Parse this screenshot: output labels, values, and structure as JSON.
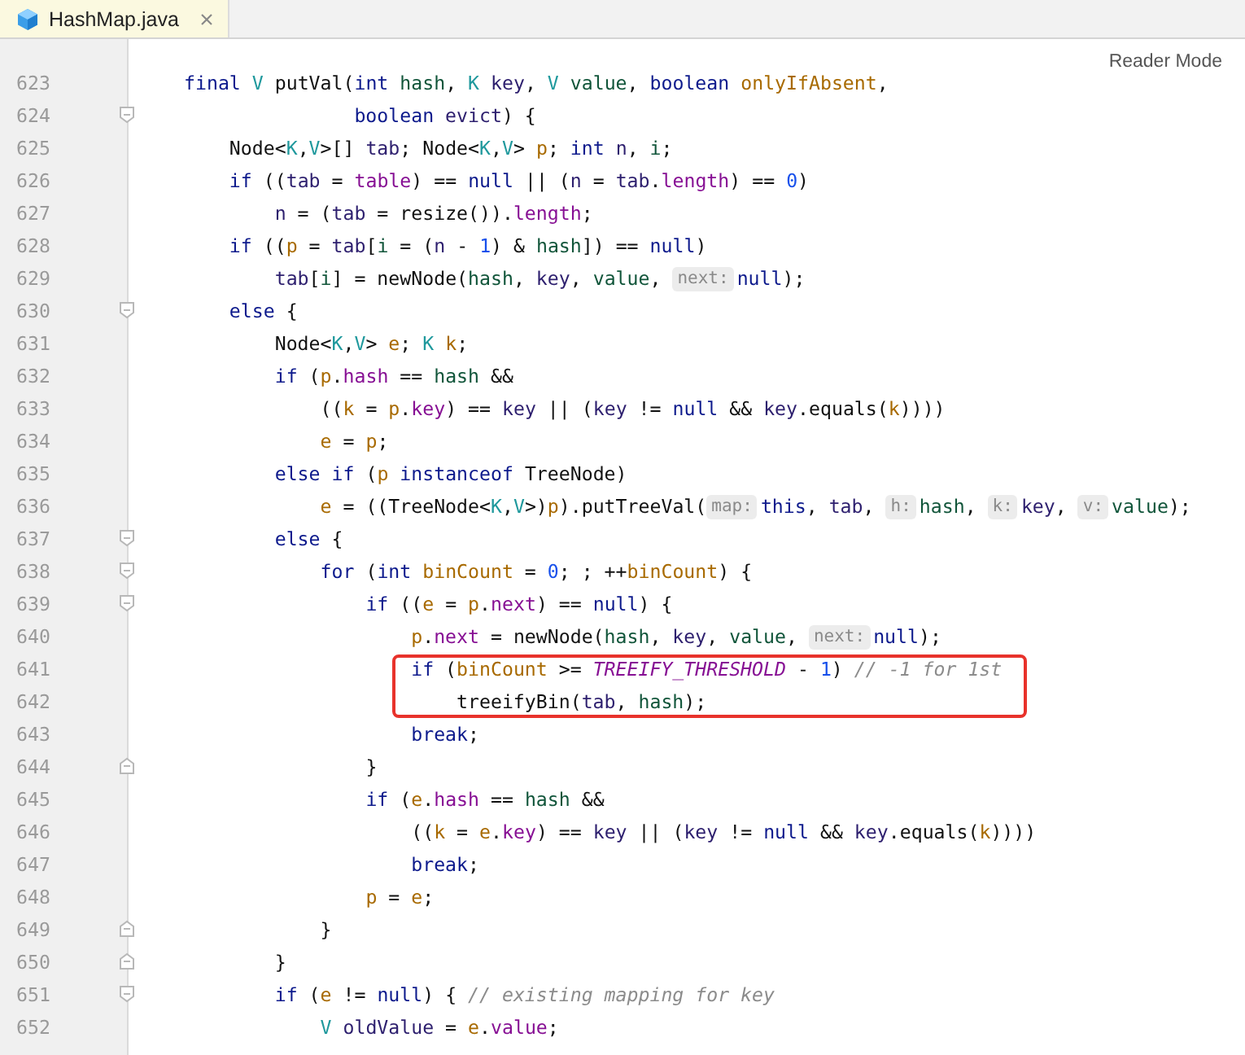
{
  "tabs": [
    {
      "label": "HashMap.java",
      "selected": true
    }
  ],
  "reader_mode": "Reader Mode",
  "lines": [
    {
      "number": "623",
      "highlighted": false,
      "fold_start": false,
      "fold_end": false,
      "tokens": [
        {
          "text": "final ",
          "kind": "kw"
        },
        {
          "text": "V",
          "kind": "type"
        },
        {
          "text": " putVal(",
          "kind": "plain"
        },
        {
          "text": "int ",
          "kind": "kw"
        },
        {
          "text": "hash",
          "kind": "green"
        },
        {
          "text": ", ",
          "kind": "plain"
        },
        {
          "text": "K ",
          "kind": "type"
        },
        {
          "text": "key",
          "kind": "local"
        },
        {
          "text": ", ",
          "kind": "plain"
        },
        {
          "text": "V ",
          "kind": "type"
        },
        {
          "text": "value",
          "kind": "green"
        },
        {
          "text": ", ",
          "kind": "plain"
        },
        {
          "text": "boolean ",
          "kind": "kw"
        },
        {
          "text": "onlyIfAbsent",
          "kind": "brown"
        },
        {
          "text": ",",
          "kind": "plain"
        }
      ]
    },
    {
      "number": "624",
      "highlighted": false,
      "fold_start": true,
      "fold_end": false,
      "tokens": [
        {
          "text": "               boolean ",
          "kind": "kw"
        },
        {
          "text": "evict",
          "kind": "local"
        },
        {
          "text": ") {",
          "kind": "plain"
        }
      ]
    },
    {
      "number": "625",
      "highlighted": false,
      "fold_start": false,
      "fold_end": false,
      "tokens": [
        {
          "text": "    Node<",
          "kind": "plain"
        },
        {
          "text": "K",
          "kind": "type"
        },
        {
          "text": ",",
          "kind": "plain"
        },
        {
          "text": "V",
          "kind": "type"
        },
        {
          "text": ">[] ",
          "kind": "plain"
        },
        {
          "text": "tab",
          "kind": "local"
        },
        {
          "text": "; Node<",
          "kind": "plain"
        },
        {
          "text": "K",
          "kind": "type"
        },
        {
          "text": ",",
          "kind": "plain"
        },
        {
          "text": "V",
          "kind": "type"
        },
        {
          "text": "> ",
          "kind": "plain"
        },
        {
          "text": "p",
          "kind": "brown"
        },
        {
          "text": "; ",
          "kind": "plain"
        },
        {
          "text": "int ",
          "kind": "kw"
        },
        {
          "text": "n",
          "kind": "local"
        },
        {
          "text": ", ",
          "kind": "plain"
        },
        {
          "text": "i",
          "kind": "green"
        },
        {
          "text": ";",
          "kind": "plain"
        }
      ]
    },
    {
      "number": "626",
      "highlighted": false,
      "fold_start": false,
      "fold_end": false,
      "tokens": [
        {
          "text": "    if",
          "kind": "kw"
        },
        {
          "text": " ((",
          "kind": "plain"
        },
        {
          "text": "tab",
          "kind": "local"
        },
        {
          "text": " = ",
          "kind": "plain"
        },
        {
          "text": "table",
          "kind": "field"
        },
        {
          "text": ") == ",
          "kind": "plain"
        },
        {
          "text": "null",
          "kind": "kw"
        },
        {
          "text": " || (",
          "kind": "plain"
        },
        {
          "text": "n",
          "kind": "local"
        },
        {
          "text": " = ",
          "kind": "plain"
        },
        {
          "text": "tab",
          "kind": "local"
        },
        {
          "text": ".",
          "kind": "plain"
        },
        {
          "text": "length",
          "kind": "field"
        },
        {
          "text": ") == ",
          "kind": "plain"
        },
        {
          "text": "0",
          "kind": "num"
        },
        {
          "text": ")",
          "kind": "plain"
        }
      ]
    },
    {
      "number": "627",
      "highlighted": false,
      "fold_start": false,
      "fold_end": false,
      "tokens": [
        {
          "text": "        n",
          "kind": "local"
        },
        {
          "text": " = (",
          "kind": "plain"
        },
        {
          "text": "tab",
          "kind": "local"
        },
        {
          "text": " = resize()).",
          "kind": "plain"
        },
        {
          "text": "length",
          "kind": "field"
        },
        {
          "text": ";",
          "kind": "plain"
        }
      ]
    },
    {
      "number": "628",
      "highlighted": false,
      "fold_start": false,
      "fold_end": false,
      "tokens": [
        {
          "text": "    if",
          "kind": "kw"
        },
        {
          "text": " ((",
          "kind": "plain"
        },
        {
          "text": "p",
          "kind": "brown"
        },
        {
          "text": " = ",
          "kind": "plain"
        },
        {
          "text": "tab",
          "kind": "local"
        },
        {
          "text": "[",
          "kind": "plain"
        },
        {
          "text": "i",
          "kind": "green"
        },
        {
          "text": " = (",
          "kind": "plain"
        },
        {
          "text": "n",
          "kind": "local"
        },
        {
          "text": " - ",
          "kind": "plain"
        },
        {
          "text": "1",
          "kind": "num"
        },
        {
          "text": ") & ",
          "kind": "plain"
        },
        {
          "text": "hash",
          "kind": "green"
        },
        {
          "text": "]) == ",
          "kind": "plain"
        },
        {
          "text": "null",
          "kind": "kw"
        },
        {
          "text": ")",
          "kind": "plain"
        }
      ]
    },
    {
      "number": "629",
      "highlighted": false,
      "fold_start": false,
      "fold_end": false,
      "tokens": [
        {
          "text": "        tab",
          "kind": "local"
        },
        {
          "text": "[",
          "kind": "plain"
        },
        {
          "text": "i",
          "kind": "green"
        },
        {
          "text": "] = newNode(",
          "kind": "plain"
        },
        {
          "text": "hash",
          "kind": "green"
        },
        {
          "text": ", ",
          "kind": "plain"
        },
        {
          "text": "key",
          "kind": "local"
        },
        {
          "text": ", ",
          "kind": "plain"
        },
        {
          "text": "value",
          "kind": "green"
        },
        {
          "text": ", ",
          "kind": "plain"
        },
        {
          "text": "next:",
          "kind": "hint"
        },
        {
          "text": "null",
          "kind": "kw"
        },
        {
          "text": ");",
          "kind": "plain"
        }
      ]
    },
    {
      "number": "630",
      "highlighted": false,
      "fold_start": true,
      "fold_end": false,
      "tokens": [
        {
          "text": "    else",
          "kind": "kw"
        },
        {
          "text": " {",
          "kind": "plain"
        }
      ]
    },
    {
      "number": "631",
      "highlighted": false,
      "fold_start": false,
      "fold_end": false,
      "tokens": [
        {
          "text": "        Node<",
          "kind": "plain"
        },
        {
          "text": "K",
          "kind": "type"
        },
        {
          "text": ",",
          "kind": "plain"
        },
        {
          "text": "V",
          "kind": "type"
        },
        {
          "text": "> ",
          "kind": "plain"
        },
        {
          "text": "e",
          "kind": "brown"
        },
        {
          "text": "; ",
          "kind": "plain"
        },
        {
          "text": "K ",
          "kind": "type"
        },
        {
          "text": "k",
          "kind": "brown"
        },
        {
          "text": ";",
          "kind": "plain"
        }
      ]
    },
    {
      "number": "632",
      "highlighted": false,
      "fold_start": false,
      "fold_end": false,
      "tokens": [
        {
          "text": "        if",
          "kind": "kw"
        },
        {
          "text": " (",
          "kind": "plain"
        },
        {
          "text": "p",
          "kind": "brown"
        },
        {
          "text": ".",
          "kind": "plain"
        },
        {
          "text": "hash",
          "kind": "field"
        },
        {
          "text": " == ",
          "kind": "plain"
        },
        {
          "text": "hash",
          "kind": "green"
        },
        {
          "text": " &&",
          "kind": "plain"
        }
      ]
    },
    {
      "number": "633",
      "highlighted": false,
      "fold_start": false,
      "fold_end": false,
      "tokens": [
        {
          "text": "            ((",
          "kind": "plain"
        },
        {
          "text": "k",
          "kind": "brown"
        },
        {
          "text": " = ",
          "kind": "plain"
        },
        {
          "text": "p",
          "kind": "brown"
        },
        {
          "text": ".",
          "kind": "plain"
        },
        {
          "text": "key",
          "kind": "field"
        },
        {
          "text": ") == ",
          "kind": "plain"
        },
        {
          "text": "key",
          "kind": "local"
        },
        {
          "text": " || (",
          "kind": "plain"
        },
        {
          "text": "key",
          "kind": "local"
        },
        {
          "text": " != ",
          "kind": "plain"
        },
        {
          "text": "null",
          "kind": "kw"
        },
        {
          "text": " && ",
          "kind": "plain"
        },
        {
          "text": "key",
          "kind": "local"
        },
        {
          "text": ".equals(",
          "kind": "plain"
        },
        {
          "text": "k",
          "kind": "brown"
        },
        {
          "text": "))))",
          "kind": "plain"
        }
      ]
    },
    {
      "number": "634",
      "highlighted": false,
      "fold_start": false,
      "fold_end": false,
      "tokens": [
        {
          "text": "            e",
          "kind": "brown"
        },
        {
          "text": " = ",
          "kind": "plain"
        },
        {
          "text": "p",
          "kind": "brown"
        },
        {
          "text": ";",
          "kind": "plain"
        }
      ]
    },
    {
      "number": "635",
      "highlighted": false,
      "fold_start": false,
      "fold_end": false,
      "tokens": [
        {
          "text": "        else if",
          "kind": "kw"
        },
        {
          "text": " (",
          "kind": "plain"
        },
        {
          "text": "p ",
          "kind": "brown"
        },
        {
          "text": "instanceof",
          "kind": "kw"
        },
        {
          "text": " TreeNode)",
          "kind": "plain"
        }
      ]
    },
    {
      "number": "636",
      "highlighted": false,
      "fold_start": false,
      "fold_end": false,
      "tokens": [
        {
          "text": "            e",
          "kind": "brown"
        },
        {
          "text": " = ((TreeNode<",
          "kind": "plain"
        },
        {
          "text": "K",
          "kind": "type"
        },
        {
          "text": ",",
          "kind": "plain"
        },
        {
          "text": "V",
          "kind": "type"
        },
        {
          "text": ">)",
          "kind": "plain"
        },
        {
          "text": "p",
          "kind": "brown"
        },
        {
          "text": ").putTreeVal(",
          "kind": "plain"
        },
        {
          "text": "map:",
          "kind": "hint"
        },
        {
          "text": "this",
          "kind": "kw"
        },
        {
          "text": ", ",
          "kind": "plain"
        },
        {
          "text": "tab",
          "kind": "local"
        },
        {
          "text": ", ",
          "kind": "plain"
        },
        {
          "text": "h:",
          "kind": "hint"
        },
        {
          "text": "hash",
          "kind": "green"
        },
        {
          "text": ", ",
          "kind": "plain"
        },
        {
          "text": "k:",
          "kind": "hint"
        },
        {
          "text": "key",
          "kind": "local"
        },
        {
          "text": ", ",
          "kind": "plain"
        },
        {
          "text": "v:",
          "kind": "hint"
        },
        {
          "text": "value",
          "kind": "green"
        },
        {
          "text": ");",
          "kind": "plain"
        }
      ]
    },
    {
      "number": "637",
      "highlighted": false,
      "fold_start": true,
      "fold_end": false,
      "tokens": [
        {
          "text": "        else",
          "kind": "kw"
        },
        {
          "text": " {",
          "kind": "plain"
        }
      ]
    },
    {
      "number": "638",
      "highlighted": false,
      "fold_start": true,
      "fold_end": false,
      "tokens": [
        {
          "text": "            for",
          "kind": "kw"
        },
        {
          "text": " (",
          "kind": "plain"
        },
        {
          "text": "int ",
          "kind": "kw"
        },
        {
          "text": "binCount",
          "kind": "brown"
        },
        {
          "text": " = ",
          "kind": "plain"
        },
        {
          "text": "0",
          "kind": "num"
        },
        {
          "text": "; ; ++",
          "kind": "plain"
        },
        {
          "text": "binCount",
          "kind": "brown"
        },
        {
          "text": ") {",
          "kind": "plain"
        }
      ]
    },
    {
      "number": "639",
      "highlighted": false,
      "fold_start": true,
      "fold_end": false,
      "tokens": [
        {
          "text": "                if",
          "kind": "kw"
        },
        {
          "text": " ((",
          "kind": "plain"
        },
        {
          "text": "e",
          "kind": "brown"
        },
        {
          "text": " = ",
          "kind": "plain"
        },
        {
          "text": "p",
          "kind": "brown"
        },
        {
          "text": ".",
          "kind": "plain"
        },
        {
          "text": "next",
          "kind": "field"
        },
        {
          "text": ") == ",
          "kind": "plain"
        },
        {
          "text": "null",
          "kind": "kw"
        },
        {
          "text": ") {",
          "kind": "plain"
        }
      ]
    },
    {
      "number": "640",
      "highlighted": false,
      "fold_start": false,
      "fold_end": false,
      "tokens": [
        {
          "text": "                    p",
          "kind": "brown"
        },
        {
          "text": ".",
          "kind": "plain"
        },
        {
          "text": "next",
          "kind": "field"
        },
        {
          "text": " = newNode(",
          "kind": "plain"
        },
        {
          "text": "hash",
          "kind": "green"
        },
        {
          "text": ", ",
          "kind": "plain"
        },
        {
          "text": "key",
          "kind": "local"
        },
        {
          "text": ", ",
          "kind": "plain"
        },
        {
          "text": "value",
          "kind": "green"
        },
        {
          "text": ", ",
          "kind": "plain"
        },
        {
          "text": "next:",
          "kind": "hint"
        },
        {
          "text": "null",
          "kind": "kw"
        },
        {
          "text": ");",
          "kind": "plain"
        }
      ]
    },
    {
      "number": "641",
      "highlighted": true,
      "fold_start": false,
      "fold_end": false,
      "tokens": [
        {
          "text": "                    if",
          "kind": "kw"
        },
        {
          "text": " (",
          "kind": "plain"
        },
        {
          "text": "binCount",
          "kind": "brown"
        },
        {
          "text": " >= ",
          "kind": "plain"
        },
        {
          "text": "TREEIFY_THRESHOLD",
          "kind": "const"
        },
        {
          "text": " - ",
          "kind": "plain"
        },
        {
          "text": "1",
          "kind": "num"
        },
        {
          "text": ") ",
          "kind": "plain"
        },
        {
          "text": "// -1 for 1st",
          "kind": "comment"
        }
      ]
    },
    {
      "number": "642",
      "highlighted": true,
      "fold_start": false,
      "fold_end": false,
      "tokens": [
        {
          "text": "                        treeifyBin(",
          "kind": "plain"
        },
        {
          "text": "tab",
          "kind": "local"
        },
        {
          "text": ", ",
          "kind": "plain"
        },
        {
          "text": "hash",
          "kind": "green"
        },
        {
          "text": ");",
          "kind": "plain"
        }
      ]
    },
    {
      "number": "643",
      "highlighted": false,
      "fold_start": false,
      "fold_end": false,
      "tokens": [
        {
          "text": "                    break",
          "kind": "kw"
        },
        {
          "text": ";",
          "kind": "plain"
        }
      ]
    },
    {
      "number": "644",
      "highlighted": false,
      "fold_start": false,
      "fold_end": true,
      "tokens": [
        {
          "text": "                }",
          "kind": "plain"
        }
      ]
    },
    {
      "number": "645",
      "highlighted": false,
      "fold_start": false,
      "fold_end": false,
      "tokens": [
        {
          "text": "                if",
          "kind": "kw"
        },
        {
          "text": " (",
          "kind": "plain"
        },
        {
          "text": "e",
          "kind": "brown"
        },
        {
          "text": ".",
          "kind": "plain"
        },
        {
          "text": "hash",
          "kind": "field"
        },
        {
          "text": " == ",
          "kind": "plain"
        },
        {
          "text": "hash",
          "kind": "green"
        },
        {
          "text": " &&",
          "kind": "plain"
        }
      ]
    },
    {
      "number": "646",
      "highlighted": false,
      "fold_start": false,
      "fold_end": false,
      "tokens": [
        {
          "text": "                    ((",
          "kind": "plain"
        },
        {
          "text": "k",
          "kind": "brown"
        },
        {
          "text": " = ",
          "kind": "plain"
        },
        {
          "text": "e",
          "kind": "brown"
        },
        {
          "text": ".",
          "kind": "plain"
        },
        {
          "text": "key",
          "kind": "field"
        },
        {
          "text": ") == ",
          "kind": "plain"
        },
        {
          "text": "key",
          "kind": "local"
        },
        {
          "text": " || (",
          "kind": "plain"
        },
        {
          "text": "key",
          "kind": "local"
        },
        {
          "text": " != ",
          "kind": "plain"
        },
        {
          "text": "null",
          "kind": "kw"
        },
        {
          "text": " && ",
          "kind": "plain"
        },
        {
          "text": "key",
          "kind": "local"
        },
        {
          "text": ".equals(",
          "kind": "plain"
        },
        {
          "text": "k",
          "kind": "brown"
        },
        {
          "text": "))))",
          "kind": "plain"
        }
      ]
    },
    {
      "number": "647",
      "highlighted": false,
      "fold_start": false,
      "fold_end": false,
      "tokens": [
        {
          "text": "                    break",
          "kind": "kw"
        },
        {
          "text": ";",
          "kind": "plain"
        }
      ]
    },
    {
      "number": "648",
      "highlighted": false,
      "fold_start": false,
      "fold_end": false,
      "tokens": [
        {
          "text": "                p",
          "kind": "brown"
        },
        {
          "text": " = ",
          "kind": "plain"
        },
        {
          "text": "e",
          "kind": "brown"
        },
        {
          "text": ";",
          "kind": "plain"
        }
      ]
    },
    {
      "number": "649",
      "highlighted": false,
      "fold_start": false,
      "fold_end": true,
      "tokens": [
        {
          "text": "            }",
          "kind": "plain"
        }
      ]
    },
    {
      "number": "650",
      "highlighted": false,
      "fold_start": false,
      "fold_end": true,
      "tokens": [
        {
          "text": "        }",
          "kind": "plain"
        }
      ]
    },
    {
      "number": "651",
      "highlighted": false,
      "fold_start": true,
      "fold_end": false,
      "tokens": [
        {
          "text": "        if",
          "kind": "kw"
        },
        {
          "text": " (",
          "kind": "plain"
        },
        {
          "text": "e",
          "kind": "brown"
        },
        {
          "text": " != ",
          "kind": "plain"
        },
        {
          "text": "null",
          "kind": "kw"
        },
        {
          "text": ") { ",
          "kind": "plain"
        },
        {
          "text": "// existing mapping for key",
          "kind": "comment"
        }
      ]
    },
    {
      "number": "652",
      "highlighted": false,
      "fold_start": false,
      "fold_end": false,
      "tokens": [
        {
          "text": "            V ",
          "kind": "type"
        },
        {
          "text": "oldValue",
          "kind": "local"
        },
        {
          "text": " = ",
          "kind": "plain"
        },
        {
          "text": "e",
          "kind": "brown"
        },
        {
          "text": ".",
          "kind": "plain"
        },
        {
          "text": "value",
          "kind": "field"
        },
        {
          "text": ";",
          "kind": "plain"
        }
      ]
    }
  ]
}
